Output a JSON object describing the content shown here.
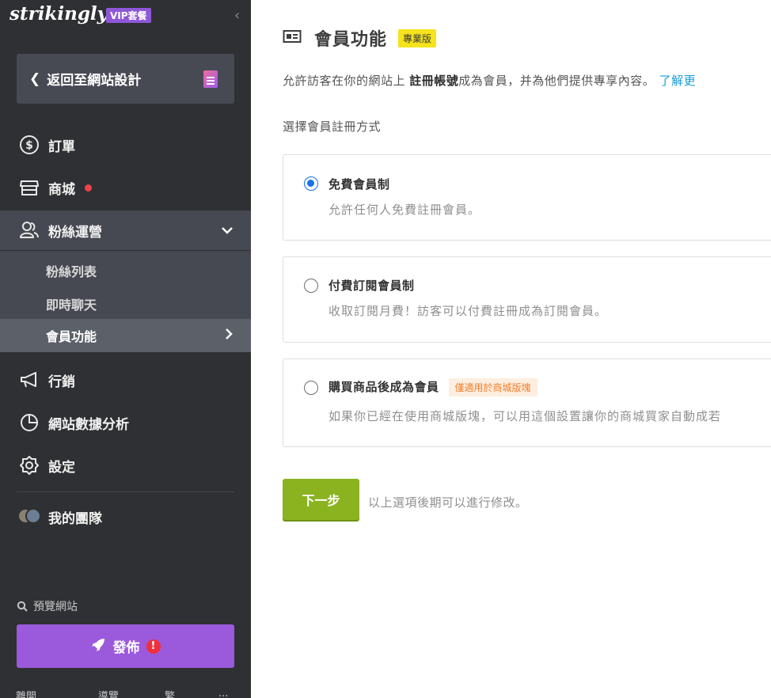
{
  "sidebar": {
    "brand": "strikingly",
    "vip_badge": "VIP套餐",
    "collapse_glyph": "‹",
    "back_label": "返回至網站設計",
    "nav": {
      "orders": "訂單",
      "store": "商城",
      "fans": "粉絲運營",
      "marketing": "行銷",
      "analytics": "網站數據分析",
      "settings": "設定",
      "team": "我的團隊"
    },
    "fans_sub": {
      "fan_list": "粉絲列表",
      "live_chat": "即時聊天",
      "membership": "會員功能"
    },
    "preview_label": "預覽網站",
    "publish_label": "發佈",
    "publish_warning": "!",
    "bottom_tabs": [
      "離開",
      "導覽",
      "繁",
      "..."
    ]
  },
  "main": {
    "title": "會員功能",
    "pro_badge": "專業版",
    "intro_prefix": "允許訪客在你的網站上 ",
    "intro_bold": "註冊帳號",
    "intro_suffix": "成為會員，并為他們提供專享內容。 ",
    "intro_link": "了解更",
    "select_label": "選擇會員註冊方式",
    "options": [
      {
        "title": "免費會員制",
        "desc": "允許任何人免費註冊會員。",
        "selected": true
      },
      {
        "title": "付費訂閱會員制",
        "desc": "收取訂閱月費！訪客可以付費註冊成為訂閱會員。",
        "selected": false
      },
      {
        "title": "購買商品後成為會員",
        "badge": "僅適用於商城版塊",
        "desc": "如果你已經在使用商城版塊，可以用這個設置讓你的商城買家自動成若",
        "selected": false
      }
    ],
    "next_button": "下一步",
    "next_note": "以上選項後期可以進行修改。"
  },
  "colors": {
    "sidebar_bg": "#2f3033",
    "active_bg": "#464951",
    "publish_purple": "#9b59dc",
    "next_green": "#8ab31f",
    "radio_blue": "#1873e6",
    "link_blue": "#1a9dd9",
    "pro_yellow": "#f6e31c"
  }
}
